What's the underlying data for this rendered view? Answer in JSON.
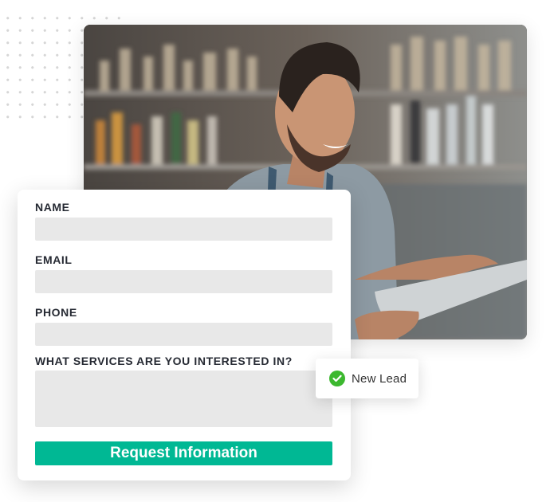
{
  "decor": {
    "dot_grid_color": "#d6d6d6"
  },
  "hero_image": {
    "description": "Smiling bartender with beard leaning over a bar, using a tablet, shelves of bottles behind him"
  },
  "form": {
    "fields": [
      {
        "label": "NAME",
        "value": "",
        "placeholder": ""
      },
      {
        "label": "EMAIL",
        "value": "",
        "placeholder": ""
      },
      {
        "label": "PHONE",
        "value": "",
        "placeholder": ""
      },
      {
        "label": "WHAT SERVICES ARE YOU INTERESTED IN?",
        "value": "",
        "placeholder": ""
      }
    ],
    "submit_label": "Request Information",
    "accent_color": "#00b894"
  },
  "toast": {
    "icon": "check-circle-icon",
    "text": "New Lead",
    "icon_color": "#3cb82f"
  }
}
